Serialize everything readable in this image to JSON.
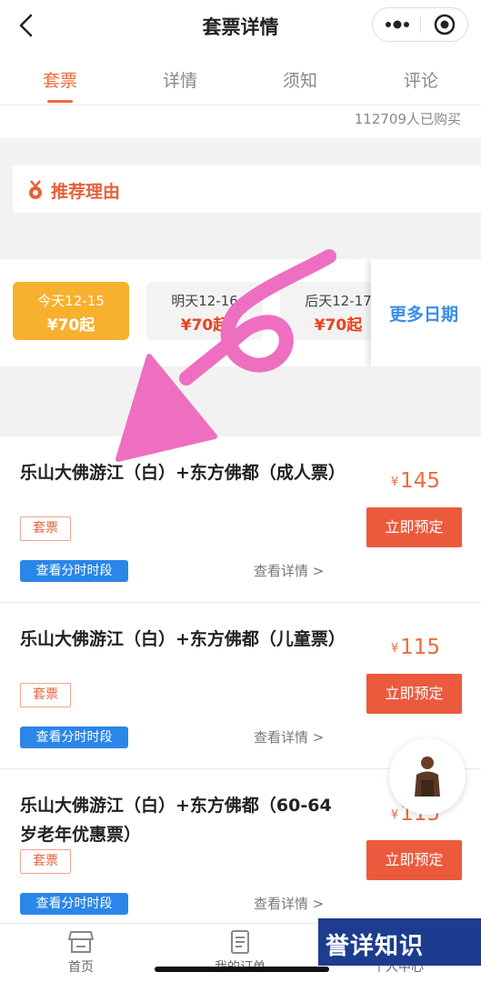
{
  "header": {
    "title": "套票详情"
  },
  "tabs": [
    {
      "label": "套票",
      "active": true
    },
    {
      "label": "详情",
      "active": false
    },
    {
      "label": "须知",
      "active": false
    },
    {
      "label": "评论",
      "active": false
    }
  ],
  "sold": {
    "text": "112709人已购买"
  },
  "reason": {
    "title": "推荐理由"
  },
  "dates": [
    {
      "label": "今天12-15",
      "price": "¥70起",
      "active": true
    },
    {
      "label": "明天12-16",
      "price": "¥70起",
      "active": false
    },
    {
      "label": "后天12-17",
      "price": "¥70起",
      "active": false
    }
  ],
  "more_dates": "更多日期",
  "tickets": [
    {
      "name": "乐山大佛游江（白）+东方佛都（成人票）",
      "tag": "套票",
      "slot": "查看分时时段",
      "detail": "查看详情 >",
      "currency": "¥",
      "price": "145",
      "book": "立即预定"
    },
    {
      "name": "乐山大佛游江（白）+东方佛都（儿童票）",
      "tag": "套票",
      "slot": "查看分时时段",
      "detail": "查看详情 >",
      "currency": "¥",
      "price": "115",
      "book": "立即预定"
    },
    {
      "name": "乐山大佛游江（白）+东方佛都（60-64岁老年优惠票）",
      "tag": "套票",
      "slot": "查看分时时段",
      "detail": "查看详情 >",
      "currency": "¥",
      "price": "115",
      "book": "立即预定"
    }
  ],
  "bottom_nav": [
    {
      "label": "首页",
      "icon": "store-icon"
    },
    {
      "label": "我的订单",
      "icon": "order-icon"
    },
    {
      "label": "个人中心",
      "icon": "profile-icon"
    }
  ],
  "watermark": {
    "text": "誉详知识"
  },
  "colors": {
    "accent": "#f06a3a",
    "book_button": "#ec5a3e",
    "date_active": "#f8b02f",
    "slot_blue": "#2a86e8",
    "annotation": "#ee6fc0"
  }
}
